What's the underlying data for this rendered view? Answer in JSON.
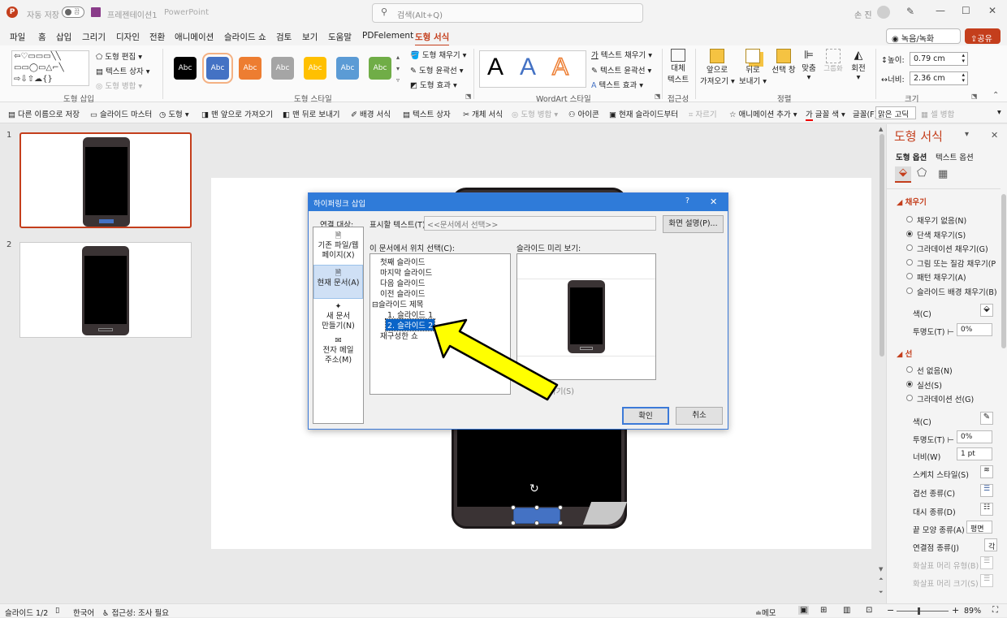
{
  "titlebar": {
    "autosave_label": "자동 저장",
    "autosave_state": "끔",
    "filename": "프레젠테이션1",
    "app": "PowerPoint",
    "search_placeholder": "검색(Alt+Q)",
    "user": "손 진"
  },
  "menu": {
    "tabs": [
      "파일",
      "홈",
      "삽입",
      "그리기",
      "디자인",
      "전환",
      "애니메이션",
      "슬라이드 쇼",
      "검토",
      "보기",
      "도움말",
      "PDFelement",
      "도형 서식"
    ],
    "active_tab": "도형 서식",
    "record_button": "녹음/녹화",
    "share_button": "공유"
  },
  "ribbon": {
    "insert_shapes": {
      "label": "도형 삽입",
      "edit_shape": "도형 편집",
      "text_box": "텍스트 상자",
      "merge_shapes": "도형 병합"
    },
    "shape_styles": {
      "label": "도형 스타일",
      "sample": "Abc",
      "swatches": [
        "#000000",
        "#4472c4",
        "#ed7d31",
        "#a5a5a5",
        "#ffc000",
        "#5b9bd5",
        "#70ad47"
      ],
      "fill": "도형 채우기",
      "outline": "도형 윤곽선",
      "effects": "도형 효과"
    },
    "wordart": {
      "label": "WordArt 스타일",
      "letter": "A",
      "text_fill": "텍스트 채우기",
      "text_outline": "텍스트 윤곽선",
      "text_effects": "텍스트 효과"
    },
    "accessibility": {
      "label": "접근성",
      "alt_text_l1": "대체",
      "alt_text_l2": "텍스트"
    },
    "arrange": {
      "label": "정렬",
      "bring_forward_l1": "앞으로",
      "bring_forward_l2": "가져오기",
      "send_backward_l1": "뒤로",
      "send_backward_l2": "보내기",
      "selection_pane": "선택 창",
      "align": "맞춤",
      "group": "그룹화",
      "rotate": "회전"
    },
    "size": {
      "label": "크기",
      "height_label": "높이:",
      "height_value": "0.79 cm",
      "width_label": "너비:",
      "width_value": "2.36 cm"
    }
  },
  "qat": {
    "items": [
      "다른 이름으로 저장",
      "슬라이드 마스터",
      "도형",
      "맨 앞으로 가져오기",
      "맨 뒤로 보내기",
      "배경 서식",
      "텍스트 상자",
      "개체 서식",
      "도형 병합",
      "아이콘",
      "현재 슬라이드부터",
      "자르기",
      "애니메이션 추가",
      "글꼴 색",
      "글꼴(F):",
      "맑은 고딕",
      "셀 병합"
    ],
    "disabled": [
      "도형 병합",
      "자르기",
      "셀 병합"
    ]
  },
  "thumbnails": [
    {
      "number": "1"
    },
    {
      "number": "2"
    }
  ],
  "dialog": {
    "title": "하이퍼링크 삽입",
    "help": "?",
    "close": "✕",
    "link_to_label": "연결 대상:",
    "link_options": [
      {
        "line1": "기존 파일/웹",
        "line2": "페이지(X)"
      },
      {
        "line1": "현재 문서(A)",
        "line2": ""
      },
      {
        "line1": "새 문서",
        "line2": "만들기(N)"
      },
      {
        "line1": "전자 메일",
        "line2": "주소(M)"
      }
    ],
    "display_text_label": "표시할 텍스트(T):",
    "display_text_value": "<<문서에서 선택>>",
    "screentip_button": "화면 설명(P)...",
    "place_label": "이 문서에서 위치 선택(C):",
    "tree": [
      "첫째 슬라이드",
      "마지막 슬라이드",
      "다음 슬라이드",
      "이전 슬라이드",
      "슬라이드 제목",
      "1. 슬라이드 1",
      "2. 슬라이드 2",
      "재구성한 쇼"
    ],
    "selected_item": "2. 슬라이드 2",
    "preview_label": "슬라이드 미리 보기:",
    "show_return_partial": "가기(S)",
    "ok": "확인",
    "cancel": "취소"
  },
  "format_pane": {
    "title": "도형 서식",
    "tabs": [
      "도형 옵션",
      "텍스트 옵션"
    ],
    "fill_section": "채우기",
    "fill_options": [
      "채우기 없음(N)",
      "단색 채우기(S)",
      "그라데이션 채우기(G)",
      "그림 또는 질감 채우기(P",
      "패턴 채우기(A)",
      "슬라이드 배경 채우기(B)"
    ],
    "fill_selected_index": 1,
    "color_label": "색(C)",
    "transparency_label": "투명도(T)",
    "transparency_value": "0%",
    "line_section": "선",
    "line_options": [
      "선 없음(N)",
      "실선(S)",
      "그라데이션 선(G)"
    ],
    "line_selected_index": 1,
    "line_color_label": "색(C)",
    "line_transparency_label": "투명도(T)",
    "line_transparency_value": "0%",
    "width_label": "너비(W)",
    "width_value": "1 pt",
    "sketch_label": "스케치 스타일(S)",
    "compound_label": "겹선 종류(C)",
    "dash_label": "대시 종류(D)",
    "cap_label": "끝 모양 종류(A)",
    "cap_value": "평면",
    "join_label": "연결점 종류(J)",
    "join_value": "각",
    "arrow_begin_label": "화살표 머리 유형(B)",
    "arrow_size_label": "화살표 머리 크기(S)"
  },
  "statusbar": {
    "slide_info": "슬라이드 1/2",
    "language": "한국어",
    "accessibility": "접근성: 조사 필요",
    "notes": "메모",
    "zoom": "89%"
  },
  "colors": {
    "accent": "#c43e1c",
    "dialog_title": "#2f7bd9",
    "selected_shape": "#4472c4",
    "arrow_fill": "#ffff00"
  }
}
